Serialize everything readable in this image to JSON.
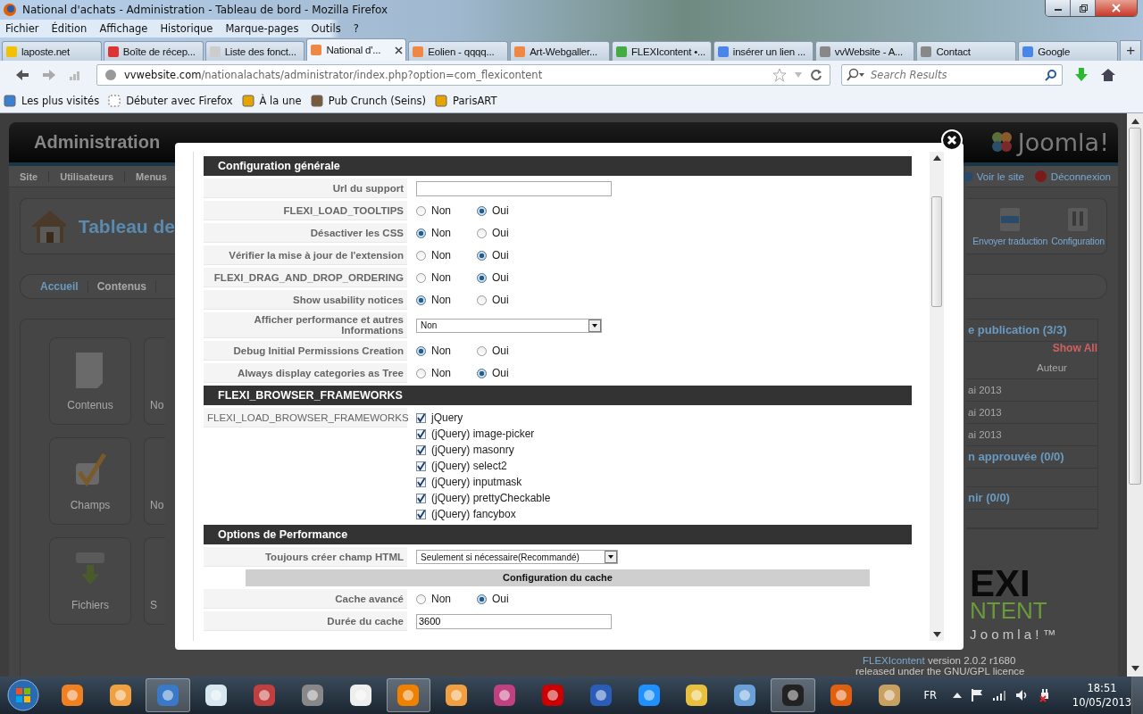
{
  "window": {
    "title": "National d'achats - Administration - Tableau de bord - Mozilla Firefox"
  },
  "menu": [
    "Fichier",
    "Édition",
    "Affichage",
    "Historique",
    "Marque-pages",
    "Outils",
    "?"
  ],
  "tabs": [
    {
      "label": "laposte.net",
      "selected": false
    },
    {
      "label": "Boîte de récep...",
      "selected": false
    },
    {
      "label": "Liste des fonct...",
      "selected": false
    },
    {
      "label": "National d'...",
      "selected": true
    },
    {
      "label": "Eolien - qqqq...",
      "selected": false
    },
    {
      "label": "Art-Webgaller...",
      "selected": false
    },
    {
      "label": "FLEXIcontent •...",
      "selected": false
    },
    {
      "label": "insérer un lien ...",
      "selected": false
    },
    {
      "label": "vvWebsite - A...",
      "selected": false
    },
    {
      "label": "Contact",
      "selected": false
    },
    {
      "label": "Google",
      "selected": false
    }
  ],
  "new_tab": "+",
  "address": {
    "host": "vvwebsite.com",
    "path": "/nationalachats/administrator/index.php?option=com_flexicontent"
  },
  "search": {
    "placeholder": "Search Results"
  },
  "bookmarks": [
    "Les plus visités",
    "Débuter avec Firefox",
    "À la une",
    "Pub Crunch (Seins)",
    "ParisART"
  ],
  "background_page": {
    "header": "Administration",
    "logo": "Joomla!",
    "submenu": [
      "Site",
      "Utilisateurs",
      "Menus"
    ],
    "links": [
      "Voir le site",
      "Déconnexion"
    ],
    "title": "Tableau de",
    "toolbar": [
      "Envoyer traduction",
      "Configuration"
    ],
    "nav": [
      "Accueil",
      "Contenus"
    ],
    "cards": [
      "Contenus",
      "Champs",
      "Fichiers"
    ],
    "cards_cut": [
      "No",
      "No",
      "S"
    ],
    "panels": [
      {
        "title": "e publication (3/3)",
        "show_all": "Show All",
        "column": "Auteur",
        "rows": [
          "ai 2013",
          "ai 2013",
          "ai 2013"
        ]
      },
      {
        "title": "n approuvée (0/0)"
      },
      {
        "title": "nir (0/0)"
      }
    ],
    "footer": {
      "logo_top": "EXI",
      "logo_bottom": "NTENT",
      "tagline": "J o o m l a ! ™",
      "link": "FLEXIcontent",
      "version": "version 2.0.2 r1680",
      "licence": "released under the GNU/GPL licence"
    }
  },
  "modal": {
    "sections": [
      {
        "title": "Configuration générale",
        "rows": [
          {
            "kind": "text",
            "label": "Url du support"
          },
          {
            "kind": "radio",
            "label": "FLEXI_LOAD_TOOLTIPS",
            "options": [
              {
                "label": "Non",
                "selected": false
              },
              {
                "label": "Oui",
                "selected": true
              }
            ]
          },
          {
            "kind": "radio",
            "label": "Désactiver les CSS",
            "options": [
              {
                "label": "Non",
                "selected": true
              },
              {
                "label": "Oui",
                "selected": false
              }
            ]
          },
          {
            "kind": "radio",
            "label": "Vérifier la mise à jour de l'extension",
            "options": [
              {
                "label": "Non",
                "selected": false
              },
              {
                "label": "Oui",
                "selected": true
              }
            ]
          },
          {
            "kind": "radio",
            "label": "FLEXI_DRAG_AND_DROP_ORDERING",
            "options": [
              {
                "label": "Non",
                "selected": false
              },
              {
                "label": "Oui",
                "selected": true
              }
            ]
          },
          {
            "kind": "radio",
            "label": "Show usability notices",
            "options": [
              {
                "label": "Non",
                "selected": true
              },
              {
                "label": "Oui",
                "selected": false
              }
            ]
          },
          {
            "kind": "select",
            "label": "Afficher performance et autres Informations",
            "value": "Non"
          },
          {
            "kind": "radio",
            "label": "Debug Initial Permissions Creation",
            "options": [
              {
                "label": "Non",
                "selected": true
              },
              {
                "label": "Oui",
                "selected": false
              }
            ]
          },
          {
            "kind": "radio",
            "label": "Always display categories as Tree",
            "options": [
              {
                "label": "Non",
                "selected": false
              },
              {
                "label": "Oui",
                "selected": true
              }
            ]
          }
        ]
      },
      {
        "title": "FLEXI_BROWSER_FRAMEWORKS",
        "rows": [
          {
            "kind": "checkboxes",
            "label": "FLEXI_LOAD_BROWSER_FRAMEWORKS",
            "options": [
              {
                "label": "jQuery",
                "checked": true
              },
              {
                "label": "(jQuery) image-picker",
                "checked": true
              },
              {
                "label": "(jQuery) masonry",
                "checked": true
              },
              {
                "label": "(jQuery) select2",
                "checked": true
              },
              {
                "label": "(jQuery) inputmask",
                "checked": true
              },
              {
                "label": "(jQuery) prettyCheckable",
                "checked": true
              },
              {
                "label": "(jQuery) fancybox",
                "checked": true
              }
            ]
          }
        ]
      },
      {
        "title": "Options de Performance",
        "rows": [
          {
            "kind": "select",
            "label": "Toujours créer champ HTML",
            "value": "Seulement si nécessaire(Recommandé)"
          },
          {
            "kind": "subheading",
            "label": "Configuration du cache"
          },
          {
            "kind": "radio",
            "label": "Cache avancé",
            "options": [
              {
                "label": "Non",
                "selected": false
              },
              {
                "label": "Oui",
                "selected": true
              }
            ]
          },
          {
            "kind": "text",
            "label": "Durée du cache",
            "value": "3600"
          }
        ]
      }
    ]
  },
  "taskbar": {
    "lang": "FR",
    "time": "18:51",
    "date": "10/05/2013"
  }
}
